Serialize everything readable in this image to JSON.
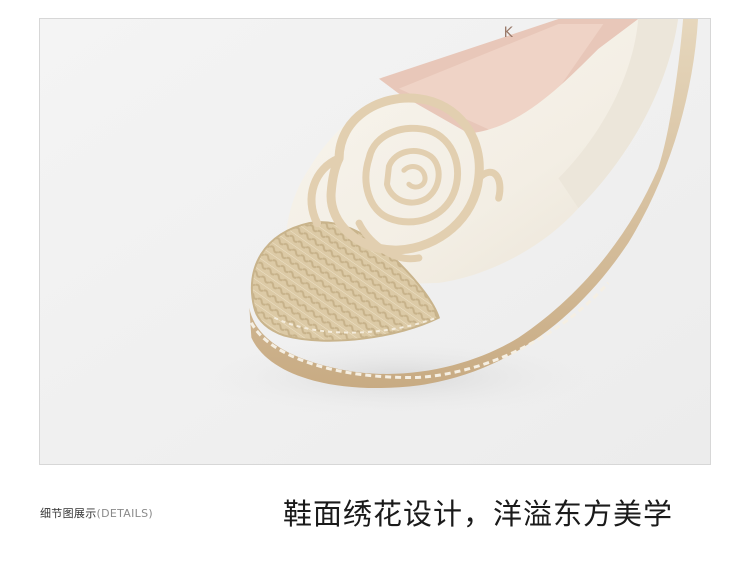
{
  "photo": {
    "subject": "close-up of a cream espadrille slip-on shoe with an embroidered camellia flower on the toe and a braided jute toe cap",
    "brand_fragment": "K"
  },
  "caption": {
    "label": "细节图展示",
    "sublabel": "(DETAILS)"
  },
  "headline": "鞋面绣花设计，洋溢东方美学",
  "colors": {
    "background": "#ffffff",
    "photo_background": "#f1f1f1",
    "frame_border": "#d7d7d7",
    "shoe_leather": "#f4efe6",
    "embroidery": "#e2cfb0",
    "jute": "#d8c6a0",
    "lining": "#e8c7b9"
  }
}
